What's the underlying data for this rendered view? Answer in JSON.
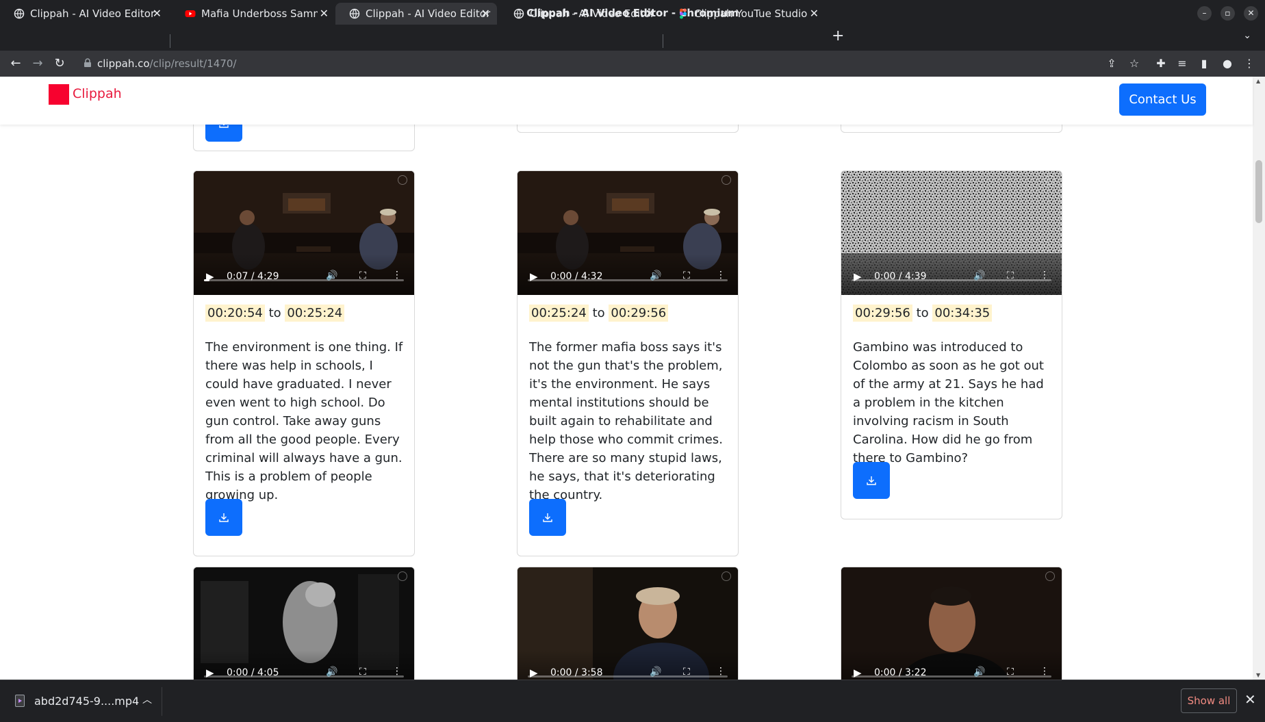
{
  "window": {
    "title": "Clippah - AI Video Editor - Chromium"
  },
  "tabs": [
    {
      "label": "Clippah - AI Video Editor",
      "favicon": "globe-icon"
    },
    {
      "label": "Mafia Underboss Sammy \"The Bull\"",
      "favicon": "youtube-icon"
    },
    {
      "label": "Clippah - AI Video Editor",
      "favicon": "globe-icon"
    },
    {
      "label": "Clippah - AI Video Editor",
      "favicon": "globe-icon"
    },
    {
      "label": "Clippah YouTue Studio Wireframe",
      "favicon": "figma-icon"
    }
  ],
  "address_bar": {
    "host": "clippah.co",
    "path": "/clip/result/1470/"
  },
  "site": {
    "brand": "Clippah",
    "contact_label": "Contact Us",
    "brand_color": "#f7022f",
    "accent_color": "#0d6efd"
  },
  "clips": [
    {
      "time": "0:07 / 4:29",
      "progress": 0.027,
      "start": "00:20:54",
      "connector": "to",
      "end": "00:25:24",
      "description": "The environment is one thing. If there was help in schools, I could have graduated. I never even went to high school. Do gun control. Take away guns from all the good people. Every criminal will always have a gun. This is a problem of people growing up."
    },
    {
      "time": "0:00 / 4:32",
      "progress": 0,
      "start": "00:25:24",
      "connector": "to",
      "end": "00:29:56",
      "description": "The former mafia boss says it's not the gun that's the problem, it's the environment. He says mental institutions should be built again to rehabilitate and help those who commit crimes. There are so many stupid laws, he says, that it's deteriorating the country."
    },
    {
      "time": "0:00 / 4:39",
      "progress": 0,
      "start": "00:29:56",
      "connector": "to",
      "end": "00:34:35",
      "description": "Gambino was introduced to Colombo as soon as he got out of the army at 21. Says he had a problem in the kitchen involving racism in South Carolina. How did he go from there to Gambino?"
    },
    {
      "time": "0:00 / 4:05",
      "progress": 0
    },
    {
      "time": "0:00 / 3:58",
      "progress": 0
    },
    {
      "time": "0:00 / 3:22",
      "progress": 0
    }
  ],
  "downloads": {
    "filename": "abd2d745-9....mp4",
    "show_all": "Show all"
  }
}
